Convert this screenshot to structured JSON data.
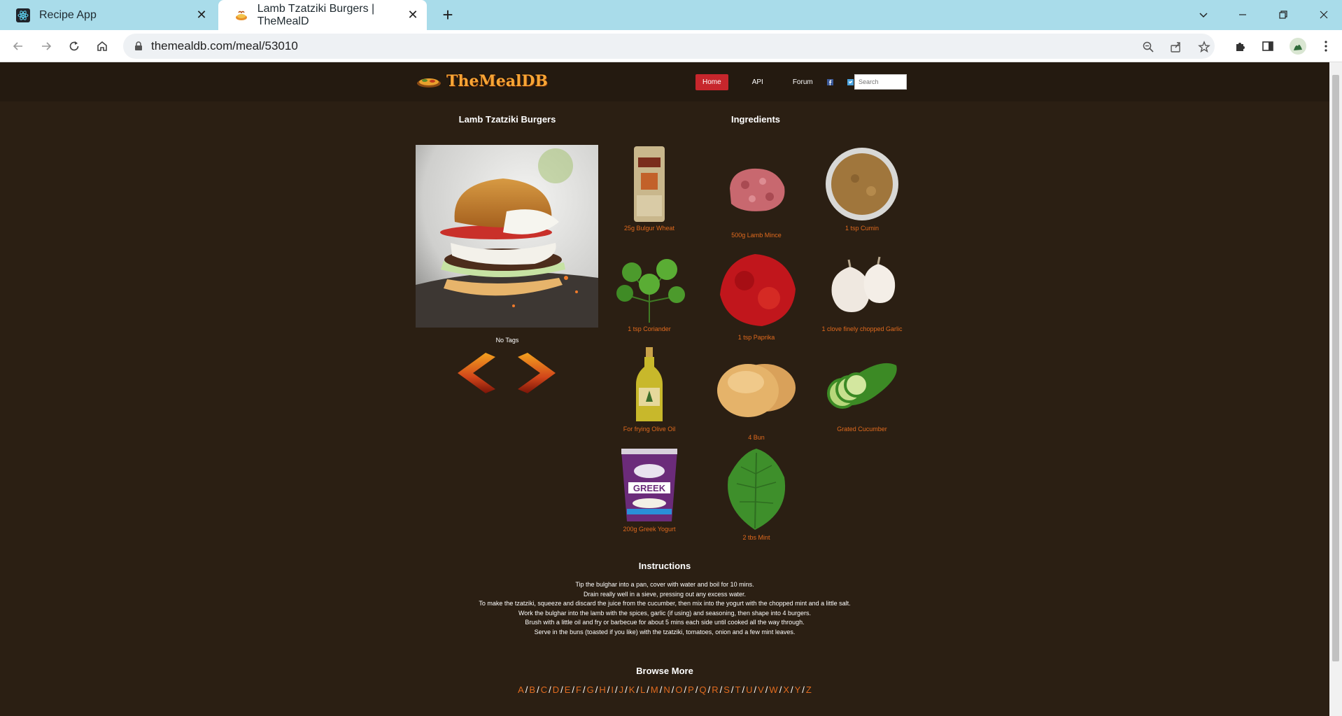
{
  "browser": {
    "tabs": [
      {
        "title": "Recipe App"
      },
      {
        "title": "Lamb Tzatziki Burgers | TheMealD"
      }
    ],
    "url": "themealdb.com/meal/53010"
  },
  "site": {
    "logo_text": "TheMealDB",
    "nav": {
      "home": "Home",
      "api": "API",
      "forum": "Forum"
    },
    "search_placeholder": "Search"
  },
  "meal": {
    "title": "Lamb Tzatziki Burgers",
    "ingredients_heading": "Ingredients",
    "tags": "No Tags",
    "ingredients": [
      {
        "label": "25g Bulgur Wheat",
        "icon": "bulgur-wheat-bag"
      },
      {
        "label": "500g Lamb Mince",
        "icon": "minced-lamb"
      },
      {
        "label": "1 tsp Cumin",
        "icon": "cumin-bowl"
      },
      {
        "label": "1 tsp Coriander",
        "icon": "coriander-herb"
      },
      {
        "label": "1 tsp Paprika",
        "icon": "paprika-powder"
      },
      {
        "label": "1 clove finely chopped Garlic",
        "icon": "garlic-bulbs"
      },
      {
        "label": "For frying Olive Oil",
        "icon": "olive-oil-bottle"
      },
      {
        "label": "4 Bun",
        "icon": "burger-buns"
      },
      {
        "label": "Grated Cucumber",
        "icon": "cucumber"
      },
      {
        "label": "200g Greek Yogurt",
        "icon": "greek-yogurt-tub"
      },
      {
        "label": "2 tbs Mint",
        "icon": "mint-leaves"
      }
    ],
    "instructions_heading": "Instructions",
    "instructions": [
      "Tip the bulghar into a pan, cover with water and boil for 10 mins.",
      "Drain really well in a sieve, pressing out any excess water.",
      "To make the tzatziki, squeeze and discard the juice from the cucumber, then mix into the yogurt with the chopped mint and a little salt.",
      "Work the bulghar into the lamb with the spices, garlic (if using) and seasoning, then shape into 4 burgers.",
      "Brush with a little oil and fry or barbecue for about 5 mins each side until cooked all the way through.",
      "Serve in the buns (toasted if you like) with the tzatziki, tomatoes, onion and a few mint leaves."
    ]
  },
  "browse": {
    "heading": "Browse More",
    "letters": [
      "A",
      "B",
      "C",
      "D",
      "E",
      "F",
      "G",
      "H",
      "I",
      "J",
      "K",
      "L",
      "M",
      "N",
      "O",
      "P",
      "Q",
      "R",
      "S",
      "T",
      "U",
      "V",
      "W",
      "X",
      "Y",
      "Z"
    ]
  },
  "colors": {
    "page_bg": "#2b1f13",
    "header_bg": "#241a10",
    "accent_orange": "#e06a1e",
    "home_red": "#c7262c",
    "tab_strip": "#a9dcea"
  }
}
